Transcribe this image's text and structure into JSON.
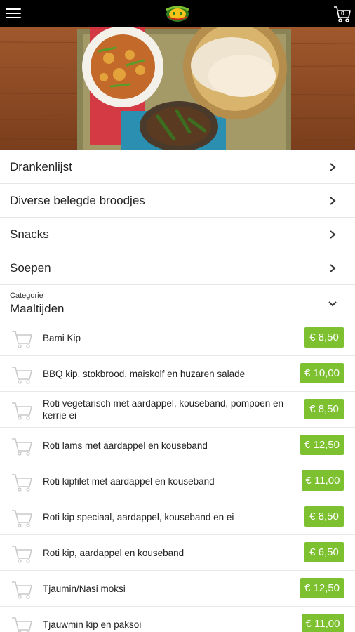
{
  "header": {
    "cart_count": "0",
    "logo_name": "restaurant-logo",
    "colors": {
      "bar": "#000000",
      "accent": "#7dc030"
    }
  },
  "hero": {
    "image_name": "food-platter-photo"
  },
  "categories": [
    {
      "label": "Drankenlijst"
    },
    {
      "label": "Diverse belegde broodjes"
    },
    {
      "label": "Snacks"
    },
    {
      "label": "Soepen"
    }
  ],
  "open_category": {
    "caption": "Categorie",
    "title": "Maaltijden"
  },
  "items": [
    {
      "name": "Bami Kip",
      "price": "€ 8,50"
    },
    {
      "name": "BBQ kip, stokbrood, maiskolf en huzaren salade",
      "price": "€ 10,00"
    },
    {
      "name": "Roti vegetarisch met aardappel, kouseband, pompoen en kerrie ei",
      "price": "€ 8,50"
    },
    {
      "name": "Roti lams met aardappel en kouseband",
      "price": "€ 12,50"
    },
    {
      "name": "Roti kipfilet met aardappel en kouseband",
      "price": "€ 11,00"
    },
    {
      "name": "Roti kip speciaal, aardappel, kouseband en ei",
      "price": "€ 8,50"
    },
    {
      "name": "Roti kip, aardappel en kouseband",
      "price": "€ 6,50"
    },
    {
      "name": "Tjaumin/Nasi moksi",
      "price": "€ 12,50"
    },
    {
      "name": "Tjauwmin kip en paksoi",
      "price": "€ 11,00"
    }
  ]
}
